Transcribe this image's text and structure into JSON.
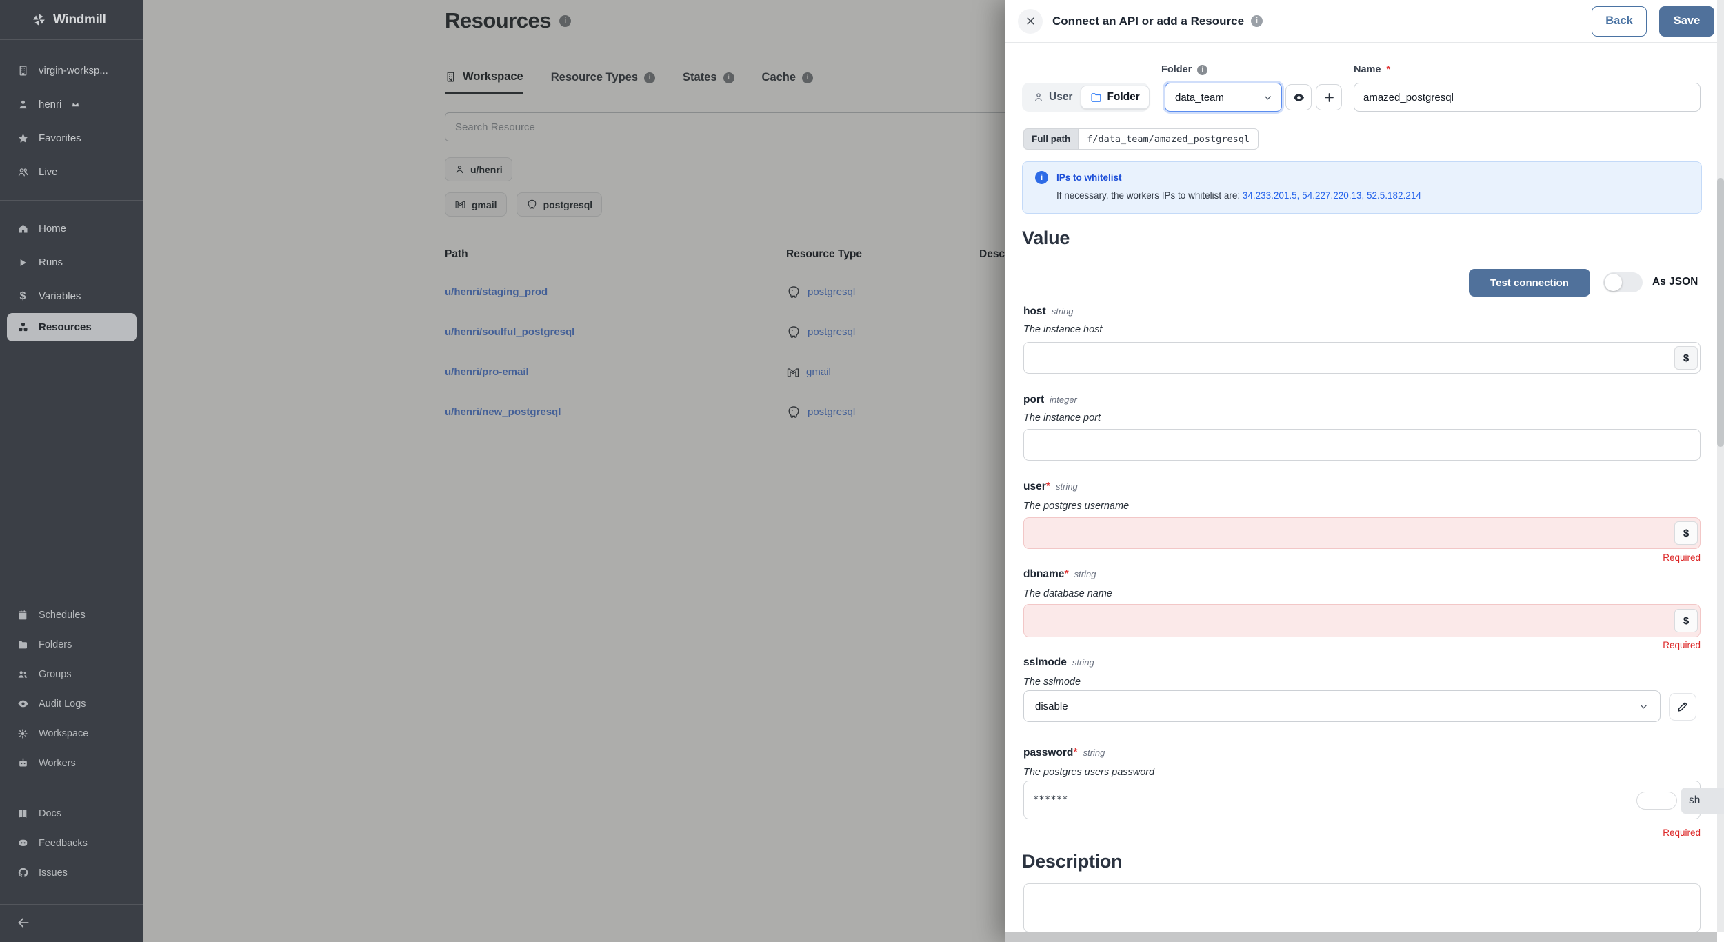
{
  "sidebar": {
    "brand": "Windmill",
    "workspace_label": "virgin-worksp...",
    "user_label": "henri",
    "favorites_label": "Favorites",
    "live_label": "Live",
    "nav": [
      {
        "label": "Home"
      },
      {
        "label": "Runs"
      },
      {
        "label": "Variables"
      },
      {
        "label": "Resources"
      }
    ],
    "admin": [
      {
        "label": "Schedules"
      },
      {
        "label": "Folders"
      },
      {
        "label": "Groups"
      },
      {
        "label": "Audit Logs"
      },
      {
        "label": "Workspace"
      },
      {
        "label": "Workers"
      }
    ],
    "links": [
      {
        "label": "Docs"
      },
      {
        "label": "Feedbacks"
      },
      {
        "label": "Issues"
      }
    ]
  },
  "main": {
    "title": "Resources",
    "tabs": [
      {
        "label": "Workspace"
      },
      {
        "label": "Resource Types"
      },
      {
        "label": "States"
      },
      {
        "label": "Cache"
      }
    ],
    "search_placeholder": "Search Resource",
    "owner_chip": "u/henri",
    "type_chips": [
      {
        "label": "gmail"
      },
      {
        "label": "postgresql"
      }
    ],
    "table": {
      "headers": [
        "Path",
        "Resource Type",
        "Description"
      ],
      "rows": [
        {
          "path": "u/henri/staging_prod",
          "type": "postgresql"
        },
        {
          "path": "u/henri/soulful_postgresql",
          "type": "postgresql"
        },
        {
          "path": "u/henri/pro-email",
          "type": "gmail"
        },
        {
          "path": "u/henri/new_postgresql",
          "type": "postgresql"
        }
      ]
    }
  },
  "drawer": {
    "title": "Connect an API or add a Resource",
    "back_label": "Back",
    "save_label": "Save",
    "folder_label": "Folder",
    "name_label": "Name",
    "star": "*",
    "owner_toggle": {
      "user": "User",
      "folder": "Folder"
    },
    "folder_value": "data_team",
    "name_value": "amazed_postgresql",
    "full_path_label": "Full path",
    "full_path_value": "f/data_team/amazed_postgresql",
    "info": {
      "title": "IPs to whitelist",
      "body": "If necessary, the workers IPs to whitelist are: ",
      "ips": "34.233.201.5, 54.227.220.13, 52.5.182.214"
    },
    "value_heading": "Value",
    "test_button": "Test connection",
    "as_json_label": "As JSON",
    "dollar": "$",
    "required_msg": "Required",
    "fields": {
      "host": {
        "name": "host",
        "type": "string",
        "desc": "The instance host"
      },
      "port": {
        "name": "port",
        "type": "integer",
        "desc": "The instance port"
      },
      "user": {
        "name": "user",
        "type": "string",
        "desc": "The postgres username"
      },
      "dbname": {
        "name": "dbname",
        "type": "string",
        "desc": "The database name"
      },
      "sslmode": {
        "name": "sslmode",
        "type": "string",
        "desc": "The sslmode",
        "value": "disable"
      },
      "password": {
        "name": "password",
        "type": "string",
        "desc": "The postgres users password",
        "value": "******"
      }
    },
    "show_tag": "sh",
    "description_heading": "Description"
  }
}
